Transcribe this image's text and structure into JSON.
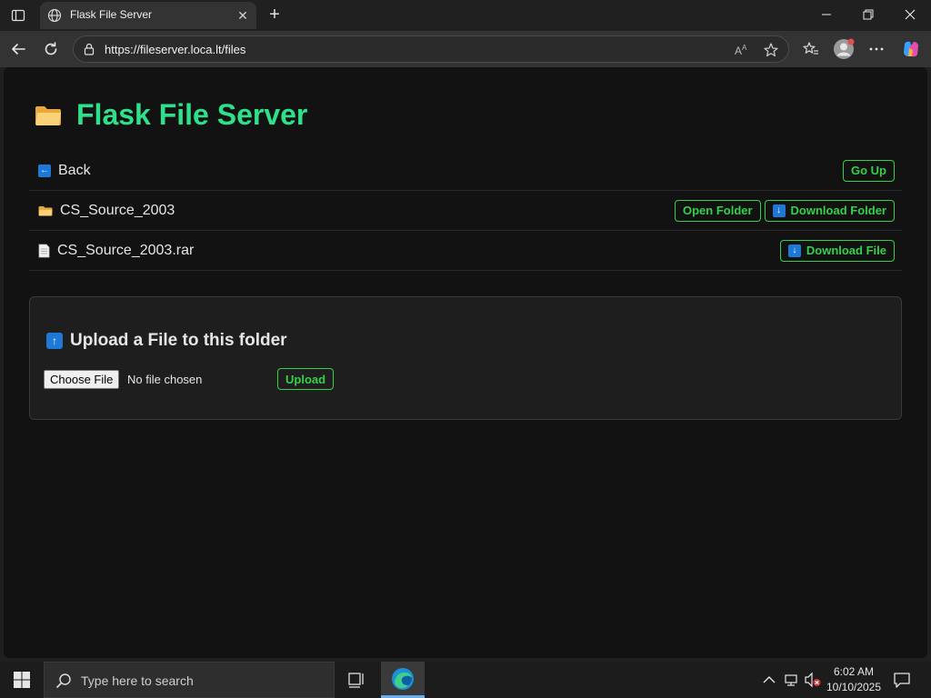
{
  "browser": {
    "tab_title": "Flask File Server",
    "url": "https://fileserver.loca.lt/files",
    "new_tab_symbol": "+",
    "close_tab_symbol": "✕"
  },
  "page": {
    "title": "Flask File Server",
    "list": [
      {
        "icon": "back-arrow-icon",
        "label": "Back",
        "buttons": [
          "Go Up"
        ]
      },
      {
        "icon": "folder-icon",
        "label": "CS_Source_2003",
        "buttons": [
          "Open Folder",
          "Download Folder"
        ]
      },
      {
        "icon": "file-icon",
        "label": "CS_Source_2003.rar",
        "buttons": [
          "Download File"
        ]
      }
    ],
    "upload": {
      "title": "Upload a File to this folder",
      "choose_label": "Choose File",
      "no_file_text": "No file chosen",
      "upload_label": "Upload"
    }
  },
  "taskbar": {
    "search_placeholder": "Type here to search",
    "time": "6:02 AM",
    "date": "10/10/2025"
  },
  "colors": {
    "accent_green": "#2fe08a",
    "button_green": "#35d04a",
    "page_bg": "#121212"
  }
}
